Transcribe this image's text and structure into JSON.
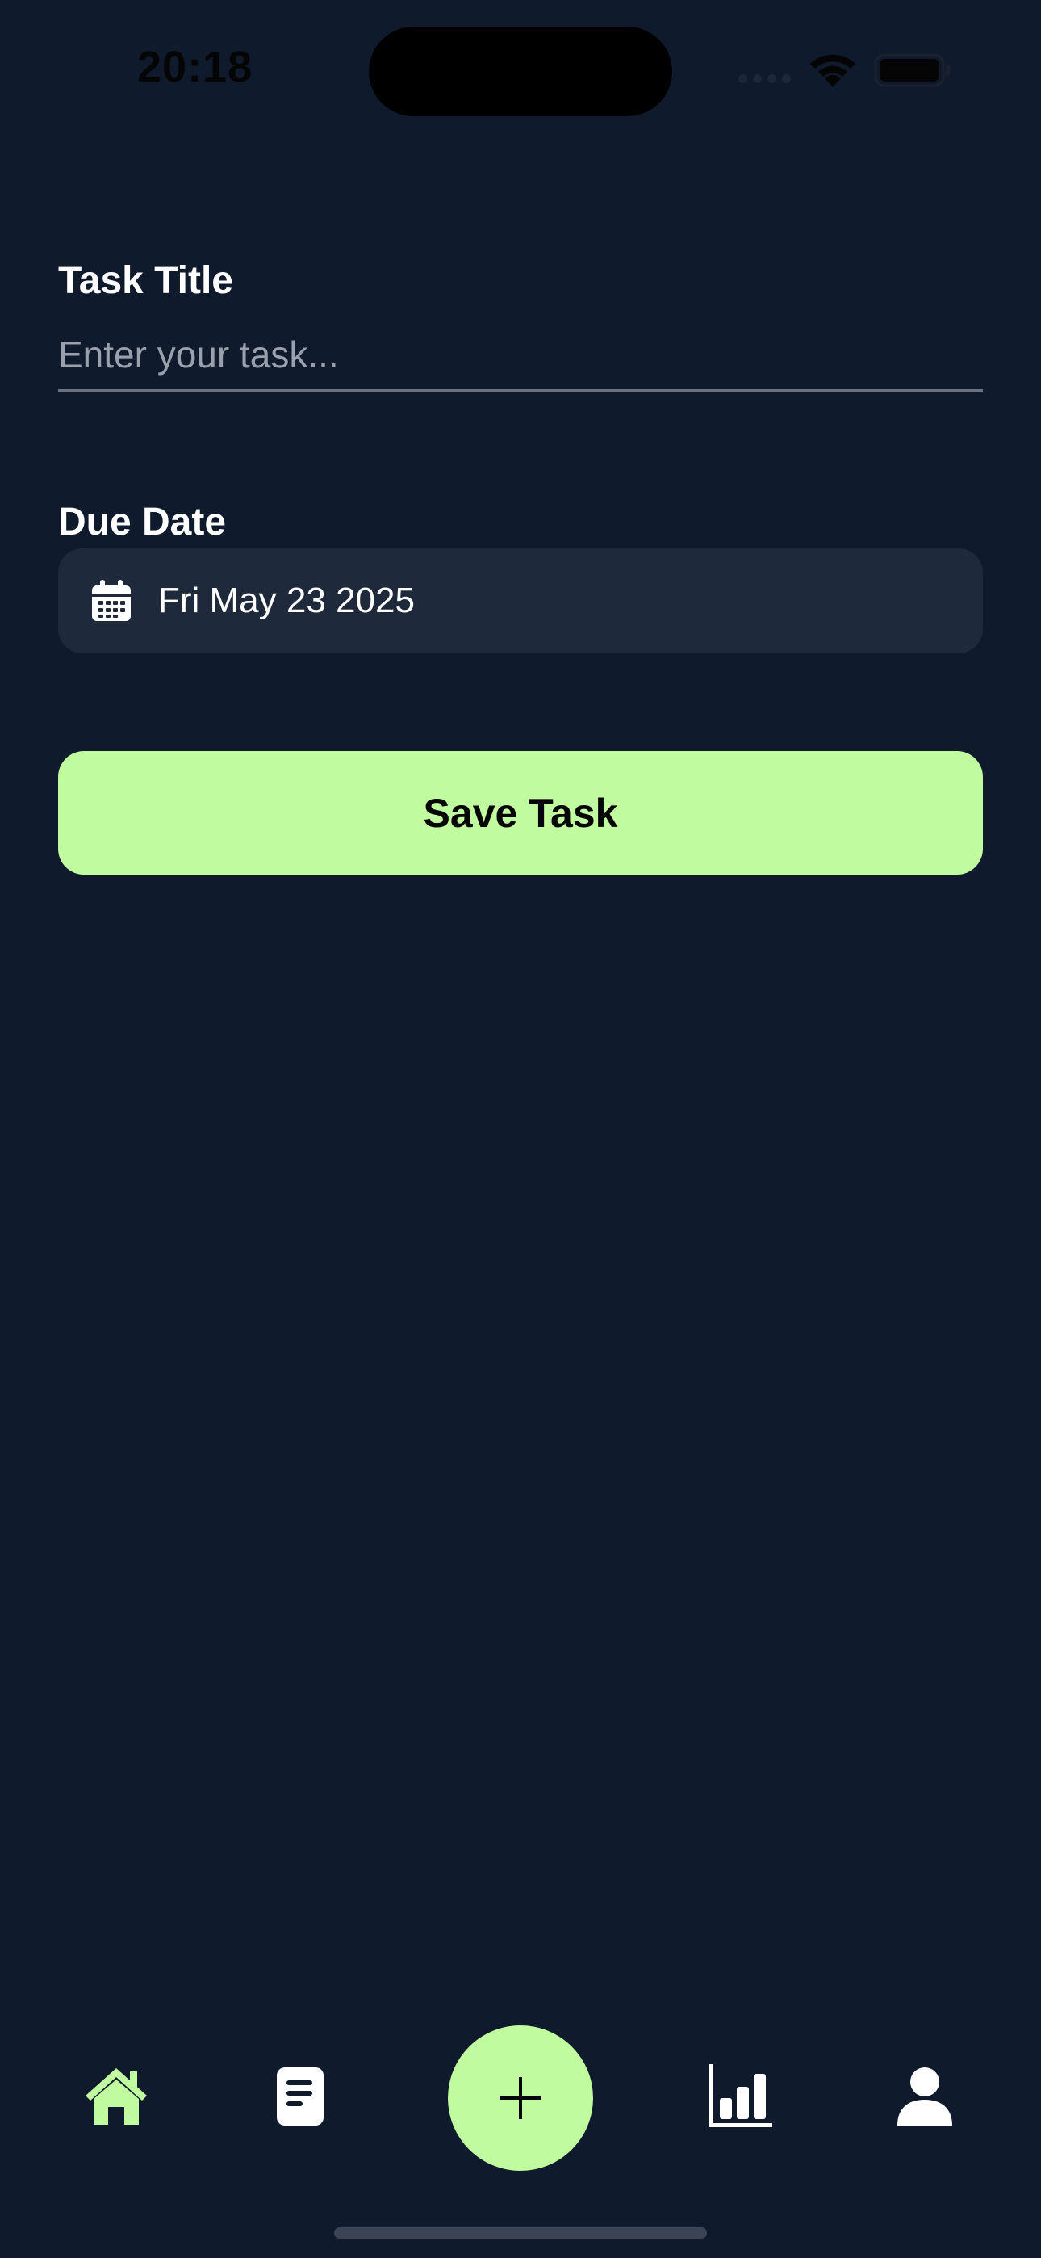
{
  "status_bar": {
    "time": "20:18"
  },
  "form": {
    "task_title_label": "Task Title",
    "task_title_value": "",
    "task_title_placeholder": "Enter your task...",
    "due_date_label": "Due Date",
    "due_date_value": "Fri May 23 2025",
    "save_label": "Save Task"
  },
  "bottom_nav": {
    "items": [
      {
        "icon": "home-icon",
        "active": true
      },
      {
        "icon": "document-icon",
        "active": false
      },
      {
        "icon": "plus-icon",
        "active": false
      },
      {
        "icon": "bar-chart-icon",
        "active": false
      },
      {
        "icon": "user-icon",
        "active": false
      }
    ]
  },
  "colors": {
    "background": "#0f1a2c",
    "surface": "#1e2a3c",
    "accent": "#c1fba0",
    "text": "#ffffff",
    "placeholder": "#9aa1ad"
  }
}
